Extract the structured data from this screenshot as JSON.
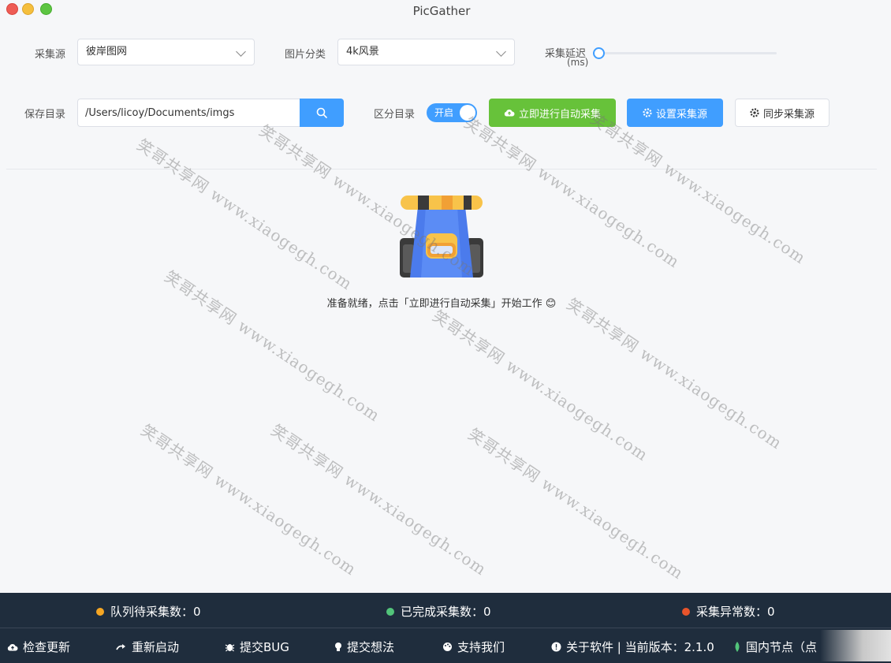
{
  "window": {
    "title": "PicGather"
  },
  "form": {
    "source_label": "采集源",
    "source_value": "彼岸图网",
    "category_label": "图片分类",
    "category_value": "4k风景",
    "delay_label_line1": "采集延迟",
    "delay_label_line2": "(ms)",
    "delay_value": 0,
    "save_dir_label": "保存目录",
    "save_dir_value": "/Users/licoy/Documents/imgs",
    "separate_dir_label": "区分目录",
    "separate_dir_toggle_text": "开启"
  },
  "actions": {
    "start_label": "立即进行自动采集",
    "setup_label": "设置采集源",
    "sync_label": "同步采集源"
  },
  "main": {
    "ready_message": "准备就绪，点击「立即进行自动采集」开始工作 😊"
  },
  "watermark_text": "笑哥共享网 www.xiaogegh.com",
  "status": {
    "queued_label": "队列待采集数：0",
    "done_label": "已完成采集数：0",
    "error_label": "采集异常数：0",
    "queued_color": "#f5a623",
    "done_color": "#52c47a",
    "error_color": "#e8542b"
  },
  "footer": {
    "check_update": "检查更新",
    "restart": "重新启动",
    "submit_bug": "提交BUG",
    "submit_idea": "提交想法",
    "support_us": "支持我们",
    "about": "关于软件 | 当前版本：2.1.0",
    "node": "国内节点（点"
  }
}
